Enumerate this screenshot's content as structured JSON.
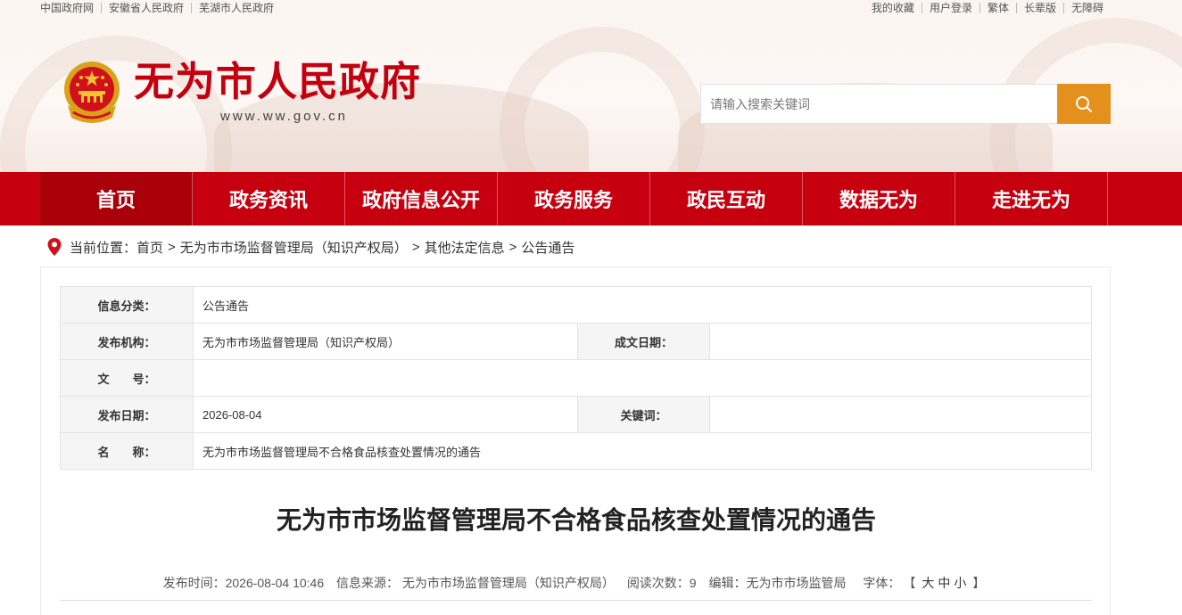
{
  "top_links": {
    "left": [
      "中国政府网",
      "安徽省人民政府",
      "芜湖市人民政府"
    ],
    "right": [
      "我的收藏",
      "用户登录",
      "繁体",
      "长辈版",
      "无障碍"
    ]
  },
  "header": {
    "title": "无为市人民政府",
    "url": "www.ww.gov.cn"
  },
  "search": {
    "placeholder": "请输入搜索关键词"
  },
  "nav": {
    "items": [
      "首页",
      "政务资讯",
      "政府信息公开",
      "政务服务",
      "政民互动",
      "数据无为",
      "走进无为"
    ]
  },
  "breadcrumb": {
    "label": "当前位置：",
    "items": [
      "首页",
      "无为市市场监督管理局（知识产权局）",
      "其他法定信息",
      "公告通告"
    ],
    "separator": ">"
  },
  "meta": {
    "category_label": "信息分类：",
    "category": "公告通告",
    "publisher_label": "发布机构：",
    "publisher": "无为市市场监督管理局（知识产权局）",
    "written_date_label": "成文日期：",
    "written_date": "",
    "doc_no_label": "文　　号：",
    "doc_no": "",
    "publish_date_label": "发布日期：",
    "publish_date": "2026-08-04",
    "keywords_label": "关键词：",
    "keywords": "",
    "name_label": "名　　称：",
    "name": "无为市市场监督管理局不合格食品核查处置情况的通告"
  },
  "article": {
    "title": "无为市市场监督管理局不合格食品核查处置情况的通告",
    "publish_time": "发布时间：2026-08-04 10:46",
    "source": "信息来源： 无为市市场监督管理局（知识产权局）",
    "views": "阅读次数：9",
    "editor": "编辑：无为市市场监管局",
    "font_size_label": "字体：",
    "font_size_open": "【",
    "font_large": "大",
    "font_medium": "中",
    "font_small": "小",
    "font_size_close": "】"
  },
  "colors": {
    "brand_red": "#c6000f",
    "nav_active": "#a90009",
    "search_button": "#e4901c"
  }
}
